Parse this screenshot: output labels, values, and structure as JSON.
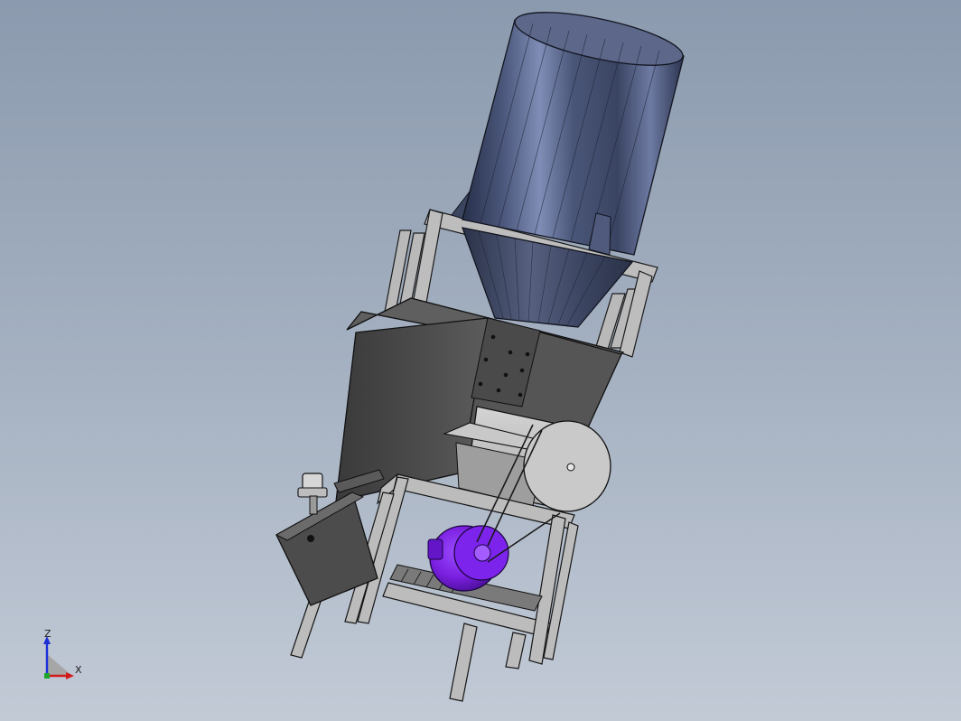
{
  "viewport": {
    "background_top": "#8b9aae",
    "background_bottom": "#c2cad6"
  },
  "model": {
    "hopper_color": "#3d4760",
    "frame_color": "#b5b5b5",
    "housing_color": "#454545",
    "motor_color": "#7a1fe0"
  },
  "triad": {
    "z_label": "Z",
    "x_label": "X",
    "z_color": "#1a2fd6",
    "x_color": "#d11a1a"
  }
}
